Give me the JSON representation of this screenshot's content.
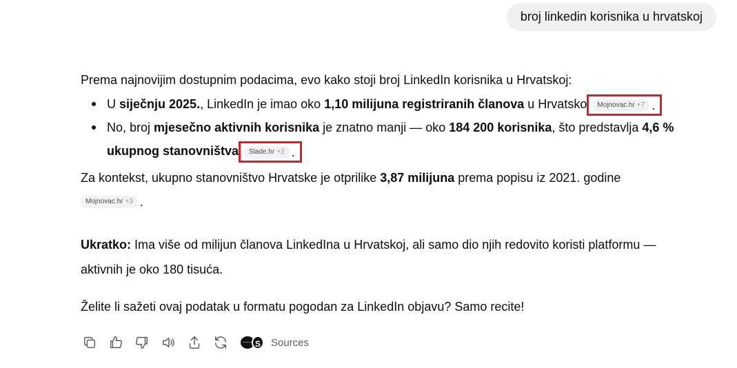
{
  "user_message": "broj linkedin korisnika u hrvatskoj",
  "answer": {
    "intro": "Prema najnovijim dostupnim podacima, evo kako stoji broj LinkedIn korisnika u Hrvatskoj:",
    "bullet1": {
      "t1": "U ",
      "b1": "siječnju 2025.",
      "t2": ", LinkedIn je imao oko ",
      "b2": "1,10 milijuna registriranih članova",
      "t3": " u Hrvatsko",
      "chip_source": "Mojnovac.hr",
      "chip_more": "+7",
      "end": "."
    },
    "bullet2": {
      "t1": "No, broj ",
      "b1": "mjesečno aktivnih korisnika",
      "t2": " je znatno manji — oko ",
      "b2": "184 200 korisnika",
      "t3": ", što predstavlja ",
      "b3": "4,6 % ukupnog stanovništva",
      "chip_source": "Slade.hr",
      "chip_more": "+2",
      "end": "."
    },
    "context": {
      "t1": "Za kontekst, ukupno stanovništvo Hrvatske je otprilike ",
      "b1": "3,87 milijuna",
      "t2": " prema popisu iz 2021. godine",
      "chip_source": "Mojnovac.hr",
      "chip_more": "+3",
      "end": "."
    },
    "summary": {
      "label": "Ukratko:",
      "text": " Ima više od milijun članova LinkedIna u Hrvatskoj, ali samo dio njih redovito koristi platformu — aktivnih je oko 180 tisuća."
    },
    "cta": "Želite li sažeti ovaj podatak u formatu pogodan za LinkedIn objavu? Samo recite!"
  },
  "toolbar": {
    "icons": [
      "copy-icon",
      "thumbs-up-icon",
      "thumbs-down-icon",
      "speaker-icon",
      "share-icon",
      "regenerate-icon"
    ],
    "sources_label": "Sources",
    "sources_glyph": "S"
  },
  "colors": {
    "highlight_box": "#e21b23",
    "chip_bg": "#f2f2f2",
    "bubble_bg": "#f0f0f0"
  }
}
